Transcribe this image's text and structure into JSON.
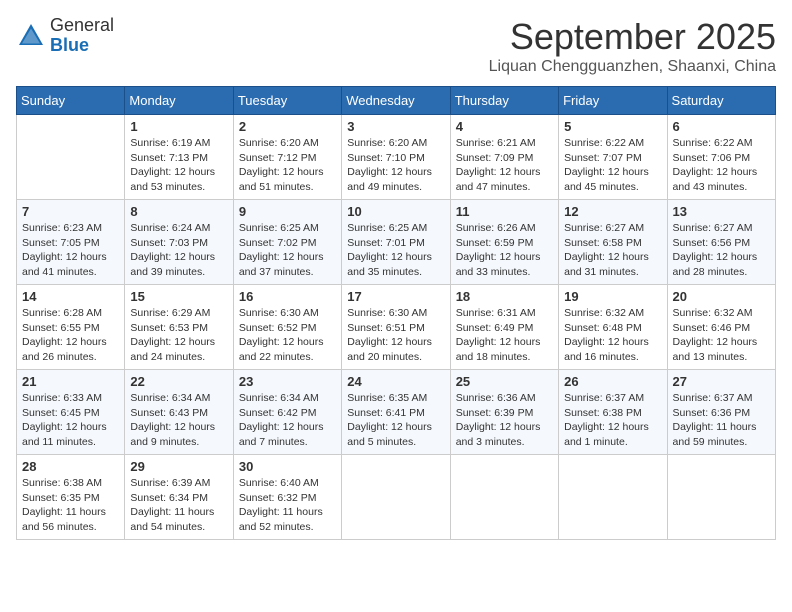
{
  "header": {
    "logo_line1": "General",
    "logo_line2": "Blue",
    "month": "September 2025",
    "location": "Liquan Chengguanzhen, Shaanxi, China"
  },
  "days_of_week": [
    "Sunday",
    "Monday",
    "Tuesday",
    "Wednesday",
    "Thursday",
    "Friday",
    "Saturday"
  ],
  "weeks": [
    [
      {
        "day": "",
        "info": ""
      },
      {
        "day": "1",
        "info": "Sunrise: 6:19 AM\nSunset: 7:13 PM\nDaylight: 12 hours\nand 53 minutes."
      },
      {
        "day": "2",
        "info": "Sunrise: 6:20 AM\nSunset: 7:12 PM\nDaylight: 12 hours\nand 51 minutes."
      },
      {
        "day": "3",
        "info": "Sunrise: 6:20 AM\nSunset: 7:10 PM\nDaylight: 12 hours\nand 49 minutes."
      },
      {
        "day": "4",
        "info": "Sunrise: 6:21 AM\nSunset: 7:09 PM\nDaylight: 12 hours\nand 47 minutes."
      },
      {
        "day": "5",
        "info": "Sunrise: 6:22 AM\nSunset: 7:07 PM\nDaylight: 12 hours\nand 45 minutes."
      },
      {
        "day": "6",
        "info": "Sunrise: 6:22 AM\nSunset: 7:06 PM\nDaylight: 12 hours\nand 43 minutes."
      }
    ],
    [
      {
        "day": "7",
        "info": "Sunrise: 6:23 AM\nSunset: 7:05 PM\nDaylight: 12 hours\nand 41 minutes."
      },
      {
        "day": "8",
        "info": "Sunrise: 6:24 AM\nSunset: 7:03 PM\nDaylight: 12 hours\nand 39 minutes."
      },
      {
        "day": "9",
        "info": "Sunrise: 6:25 AM\nSunset: 7:02 PM\nDaylight: 12 hours\nand 37 minutes."
      },
      {
        "day": "10",
        "info": "Sunrise: 6:25 AM\nSunset: 7:01 PM\nDaylight: 12 hours\nand 35 minutes."
      },
      {
        "day": "11",
        "info": "Sunrise: 6:26 AM\nSunset: 6:59 PM\nDaylight: 12 hours\nand 33 minutes."
      },
      {
        "day": "12",
        "info": "Sunrise: 6:27 AM\nSunset: 6:58 PM\nDaylight: 12 hours\nand 31 minutes."
      },
      {
        "day": "13",
        "info": "Sunrise: 6:27 AM\nSunset: 6:56 PM\nDaylight: 12 hours\nand 28 minutes."
      }
    ],
    [
      {
        "day": "14",
        "info": "Sunrise: 6:28 AM\nSunset: 6:55 PM\nDaylight: 12 hours\nand 26 minutes."
      },
      {
        "day": "15",
        "info": "Sunrise: 6:29 AM\nSunset: 6:53 PM\nDaylight: 12 hours\nand 24 minutes."
      },
      {
        "day": "16",
        "info": "Sunrise: 6:30 AM\nSunset: 6:52 PM\nDaylight: 12 hours\nand 22 minutes."
      },
      {
        "day": "17",
        "info": "Sunrise: 6:30 AM\nSunset: 6:51 PM\nDaylight: 12 hours\nand 20 minutes."
      },
      {
        "day": "18",
        "info": "Sunrise: 6:31 AM\nSunset: 6:49 PM\nDaylight: 12 hours\nand 18 minutes."
      },
      {
        "day": "19",
        "info": "Sunrise: 6:32 AM\nSunset: 6:48 PM\nDaylight: 12 hours\nand 16 minutes."
      },
      {
        "day": "20",
        "info": "Sunrise: 6:32 AM\nSunset: 6:46 PM\nDaylight: 12 hours\nand 13 minutes."
      }
    ],
    [
      {
        "day": "21",
        "info": "Sunrise: 6:33 AM\nSunset: 6:45 PM\nDaylight: 12 hours\nand 11 minutes."
      },
      {
        "day": "22",
        "info": "Sunrise: 6:34 AM\nSunset: 6:43 PM\nDaylight: 12 hours\nand 9 minutes."
      },
      {
        "day": "23",
        "info": "Sunrise: 6:34 AM\nSunset: 6:42 PM\nDaylight: 12 hours\nand 7 minutes."
      },
      {
        "day": "24",
        "info": "Sunrise: 6:35 AM\nSunset: 6:41 PM\nDaylight: 12 hours\nand 5 minutes."
      },
      {
        "day": "25",
        "info": "Sunrise: 6:36 AM\nSunset: 6:39 PM\nDaylight: 12 hours\nand 3 minutes."
      },
      {
        "day": "26",
        "info": "Sunrise: 6:37 AM\nSunset: 6:38 PM\nDaylight: 12 hours\nand 1 minute."
      },
      {
        "day": "27",
        "info": "Sunrise: 6:37 AM\nSunset: 6:36 PM\nDaylight: 11 hours\nand 59 minutes."
      }
    ],
    [
      {
        "day": "28",
        "info": "Sunrise: 6:38 AM\nSunset: 6:35 PM\nDaylight: 11 hours\nand 56 minutes."
      },
      {
        "day": "29",
        "info": "Sunrise: 6:39 AM\nSunset: 6:34 PM\nDaylight: 11 hours\nand 54 minutes."
      },
      {
        "day": "30",
        "info": "Sunrise: 6:40 AM\nSunset: 6:32 PM\nDaylight: 11 hours\nand 52 minutes."
      },
      {
        "day": "",
        "info": ""
      },
      {
        "day": "",
        "info": ""
      },
      {
        "day": "",
        "info": ""
      },
      {
        "day": "",
        "info": ""
      }
    ]
  ]
}
